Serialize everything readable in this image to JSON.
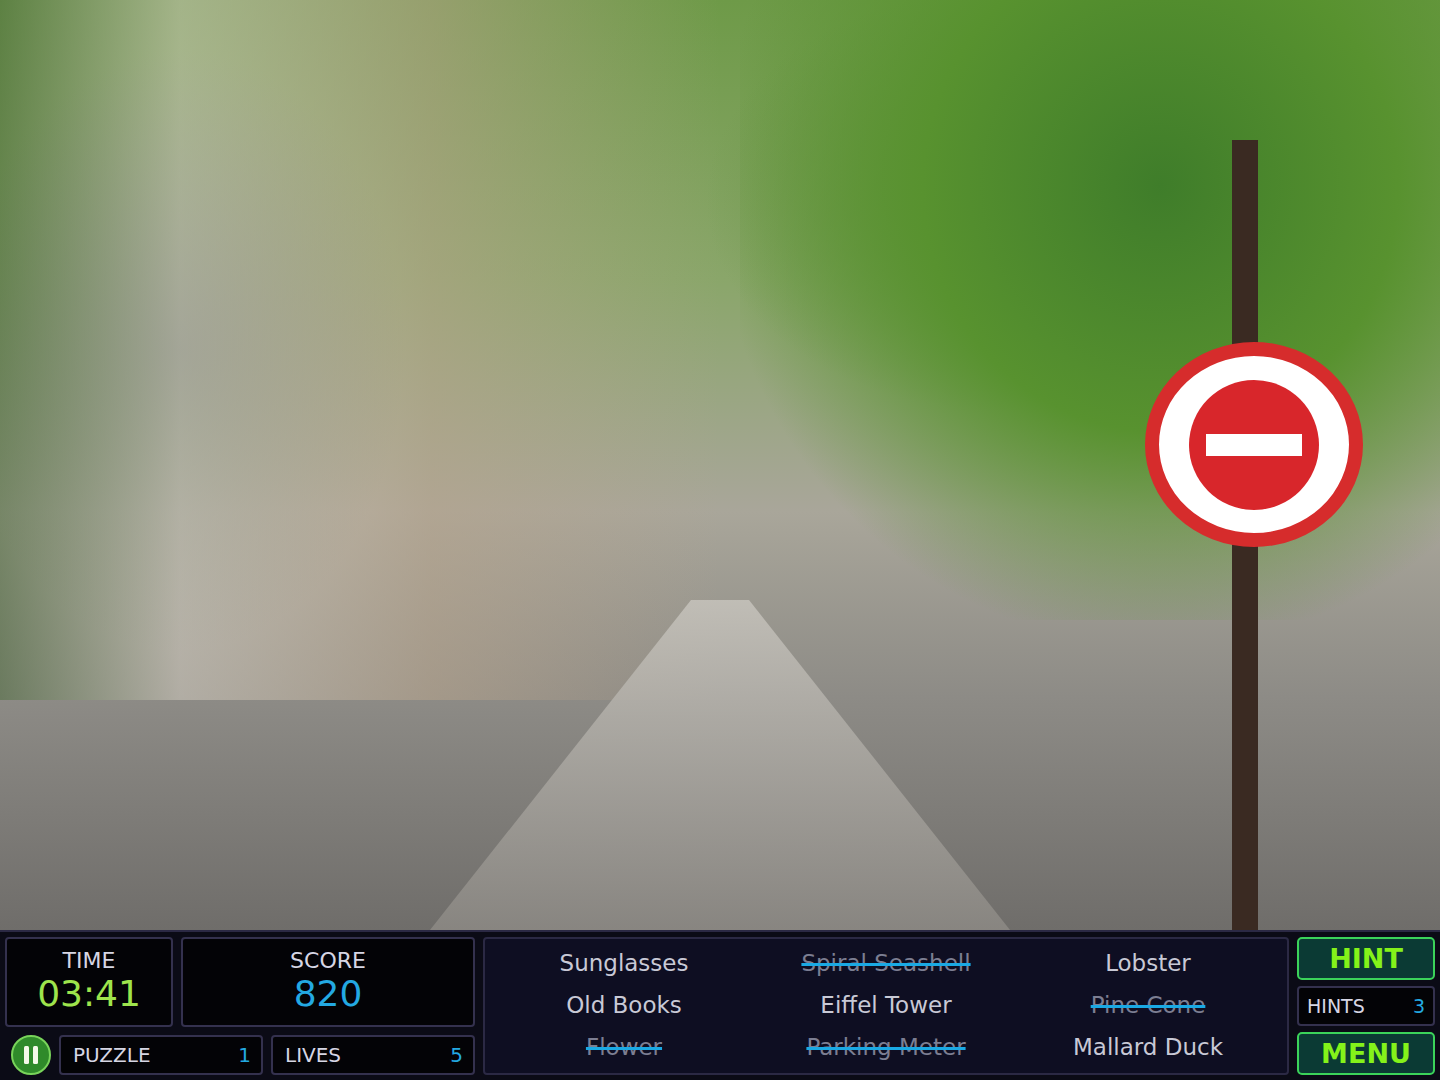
{
  "hud": {
    "time": {
      "label": "TIME",
      "value": "03:41"
    },
    "score": {
      "label": "SCORE",
      "value": "820"
    },
    "puzzle": {
      "label": "PUZZLE",
      "value": "1"
    },
    "lives": {
      "label": "LIVES",
      "value": "5"
    }
  },
  "items": [
    {
      "label": "Sunglasses",
      "found": false
    },
    {
      "label": "Spiral Seashell",
      "found": true
    },
    {
      "label": "Lobster",
      "found": false
    },
    {
      "label": "Old Books",
      "found": false
    },
    {
      "label": "Eiffel Tower",
      "found": false
    },
    {
      "label": "Pine Cone",
      "found": true
    },
    {
      "label": "Flower",
      "found": true
    },
    {
      "label": "Parking Meter",
      "found": true
    },
    {
      "label": "Mallard Duck",
      "found": false
    }
  ],
  "hint_button": "HINT",
  "hints": {
    "label": "HINTS",
    "value": "3"
  },
  "menu_button": "MENU"
}
